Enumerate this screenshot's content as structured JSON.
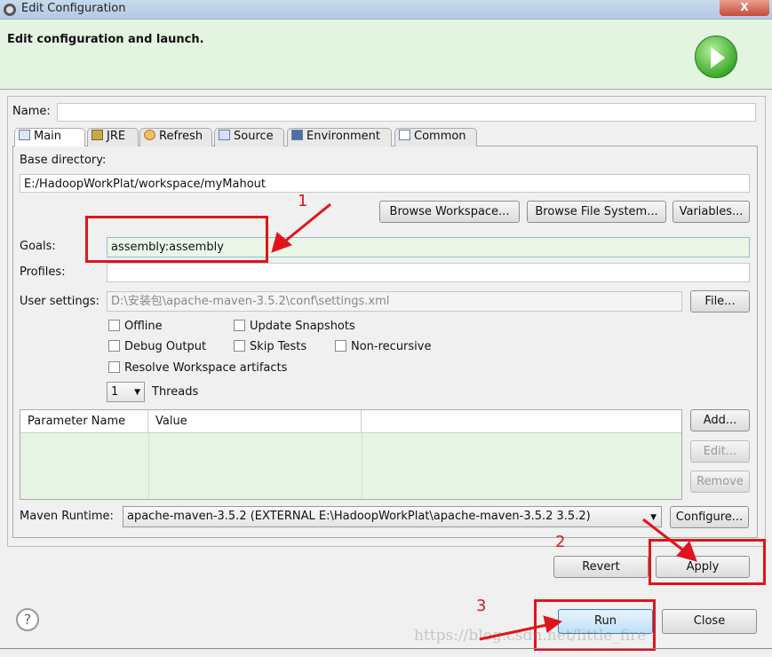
{
  "window": {
    "title": "Edit Configuration",
    "close_label": "X"
  },
  "header": {
    "text": "Edit configuration and launch.",
    "icon": "run-launch-icon"
  },
  "name": {
    "label": "Name:",
    "value": ""
  },
  "tabs": [
    {
      "label": "Main",
      "icon": "main-tab-icon"
    },
    {
      "label": "JRE",
      "icon": "jre-icon"
    },
    {
      "label": "Refresh",
      "icon": "refresh-icon"
    },
    {
      "label": "Source",
      "icon": "source-icon"
    },
    {
      "label": "Environment",
      "icon": "environment-icon"
    },
    {
      "label": "Common",
      "icon": "common-icon"
    }
  ],
  "main": {
    "base_directory": {
      "label": "Base directory:",
      "value": "E:/HadoopWorkPlat/workspace/myMahout"
    },
    "browse_workspace": "Browse Workspace...",
    "browse_fs": "Browse File System...",
    "variables": "Variables...",
    "goals": {
      "label": "Goals:",
      "value": "assembly:assembly"
    },
    "profiles": {
      "label": "Profiles:",
      "value": ""
    },
    "user_settings": {
      "label": "User settings:",
      "value": "D:\\安装包\\apache-maven-3.5.2\\conf\\settings.xml",
      "file_button": "File..."
    },
    "checkboxes": {
      "offline": "Offline",
      "update_snapshots": "Update Snapshots",
      "debug_output": "Debug Output",
      "skip_tests": "Skip Tests",
      "non_recursive": "Non-recursive",
      "resolve_workspace": "Resolve Workspace artifacts"
    },
    "threads": {
      "value": "1",
      "label": "Threads"
    },
    "params": {
      "columns": [
        "Parameter Name",
        "Value"
      ],
      "add": "Add...",
      "edit": "Edit...",
      "remove": "Remove"
    },
    "runtime": {
      "label": "Maven Runtime:",
      "value": "apache-maven-3.5.2 (EXTERNAL E:\\HadoopWorkPlat\\apache-maven-3.5.2 3.5.2)",
      "configure": "Configure..."
    }
  },
  "actions": {
    "revert": "Revert",
    "apply": "Apply",
    "run": "Run",
    "close": "Close"
  },
  "annotations": {
    "step1": "1",
    "step2": "2",
    "step3": "3",
    "color": "#e1141b"
  },
  "watermark": "https://blog.csdn.net/little_fire"
}
